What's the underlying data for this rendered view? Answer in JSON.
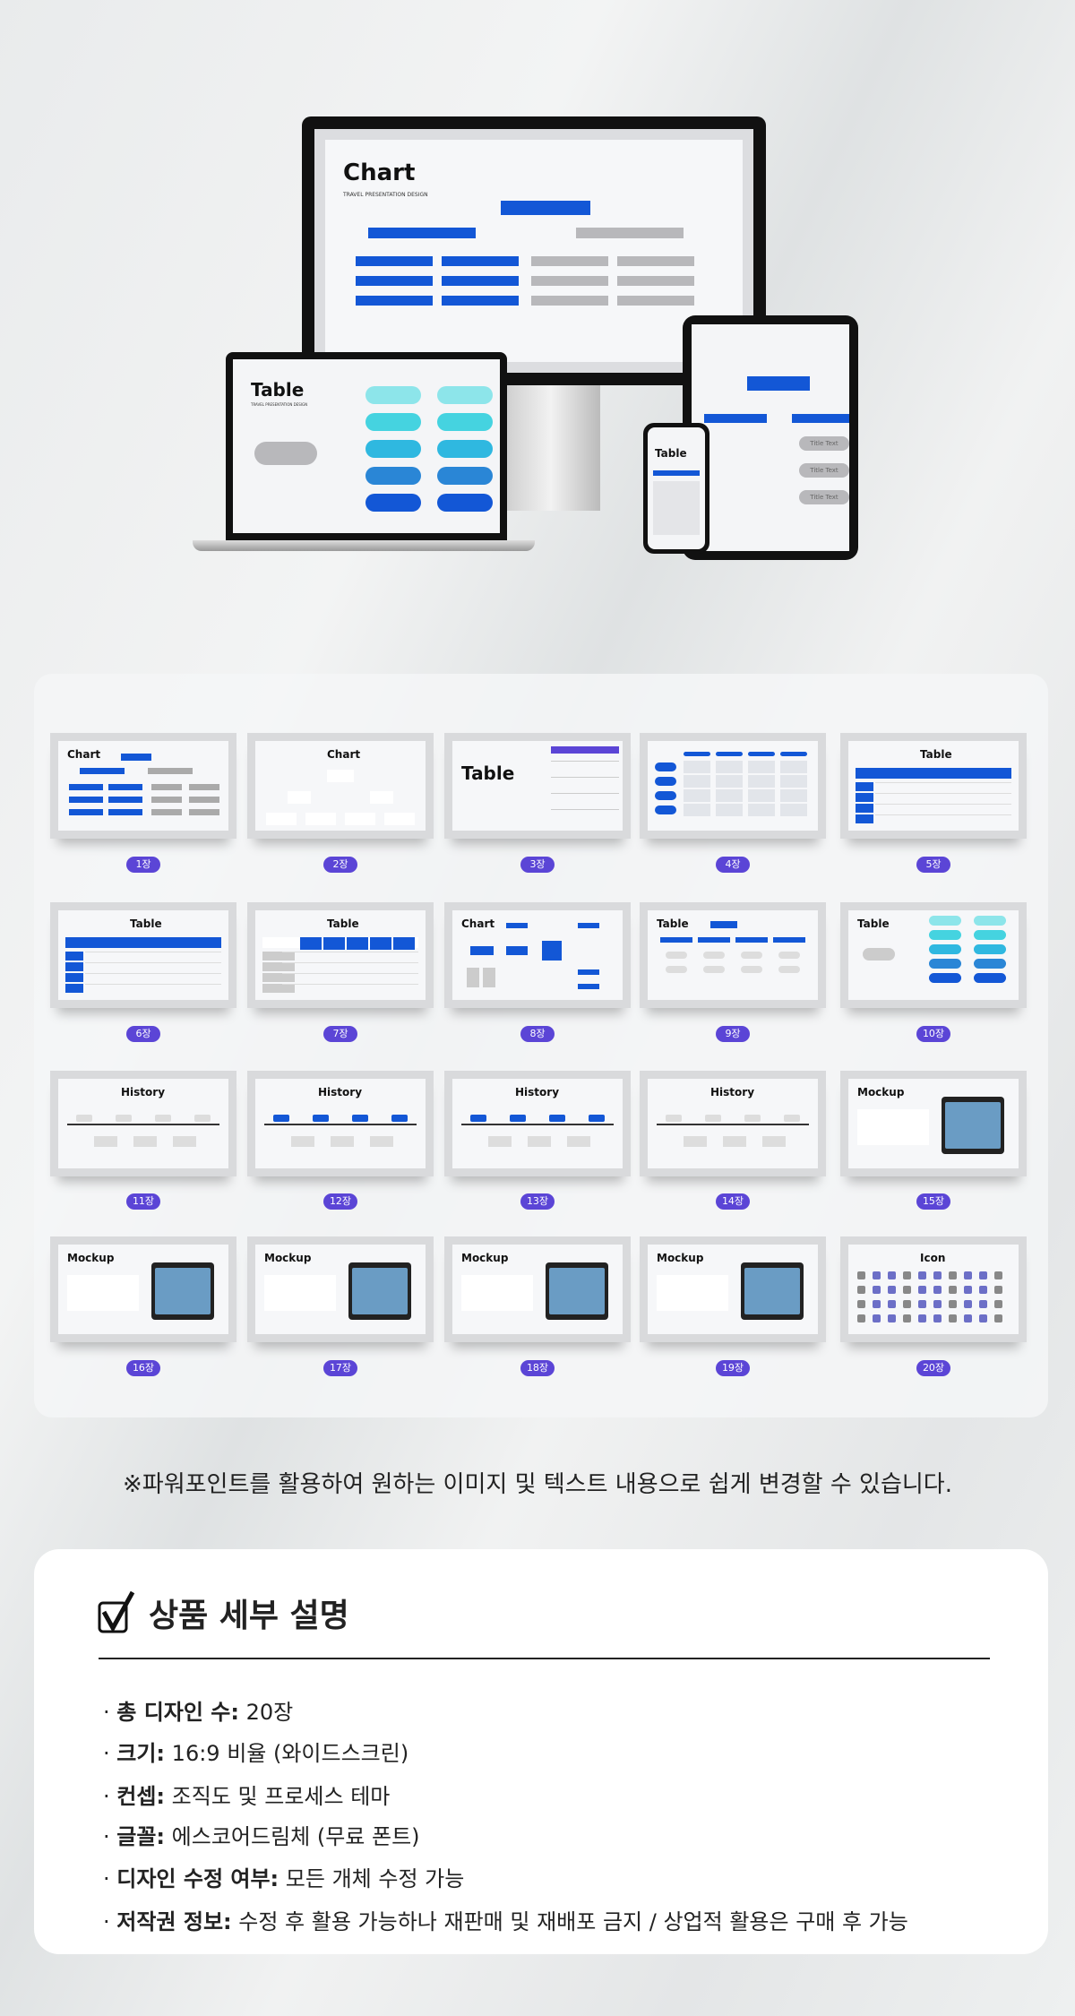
{
  "devices": {
    "monitor": {
      "title": "Chart",
      "subtitle": "TRAVEL PRESENTATION DESIGN"
    },
    "laptop": {
      "title": "Table",
      "subtitle": "TRAVEL PRESENTATION DESIGN"
    },
    "tablet": {
      "labels": [
        "Title Text",
        "Title Text",
        "Title Text"
      ]
    },
    "phone": {
      "title": "Table"
    }
  },
  "slides": [
    {
      "title": "Chart",
      "badge": "1장",
      "kind": "org"
    },
    {
      "title": "Chart",
      "badge": "2장",
      "kind": "org2"
    },
    {
      "title": "Table",
      "badge": "3장",
      "kind": "table3"
    },
    {
      "title": "",
      "badge": "4장",
      "kind": "table4"
    },
    {
      "title": "Table",
      "badge": "5장",
      "kind": "table"
    },
    {
      "title": "Table",
      "badge": "6장",
      "kind": "table"
    },
    {
      "title": "Table",
      "badge": "7장",
      "kind": "table7"
    },
    {
      "title": "Chart",
      "badge": "8장",
      "kind": "flow"
    },
    {
      "title": "Table",
      "badge": "9장",
      "kind": "tree"
    },
    {
      "title": "Table",
      "badge": "10장",
      "kind": "pills"
    },
    {
      "title": "History",
      "badge": "11장",
      "kind": "timeline"
    },
    {
      "title": "History",
      "badge": "12장",
      "kind": "history"
    },
    {
      "title": "History",
      "badge": "13장",
      "kind": "history"
    },
    {
      "title": "History",
      "badge": "14장",
      "kind": "timeline"
    },
    {
      "title": "Mockup",
      "badge": "15장",
      "kind": "mockup"
    },
    {
      "title": "Mockup",
      "badge": "16장",
      "kind": "mockup"
    },
    {
      "title": "Mockup",
      "badge": "17장",
      "kind": "mockup"
    },
    {
      "title": "Mockup",
      "badge": "18장",
      "kind": "mockup"
    },
    {
      "title": "Mockup",
      "badge": "19장",
      "kind": "mockup"
    },
    {
      "title": "Icon",
      "badge": "20장",
      "kind": "icons"
    }
  ],
  "caption": "※파워포인트를 활용하여 원하는 이미지 및 텍스트 내용으로 쉽게 변경할 수 있습니다.",
  "details": {
    "title": "상품 세부 설명",
    "items": [
      {
        "label": "총 디자인 수:",
        "value": "20장"
      },
      {
        "label": "크기:",
        "value": "16:9 비율 (와이드스크린)"
      },
      {
        "label": "컨셉:",
        "value": "조직도 및 프로세스 테마"
      },
      {
        "label": "글꼴:",
        "value": "에스코어드림체 (무료 폰트)"
      },
      {
        "label": "디자인 수정 여부:",
        "value": "모든 개체 수정 가능"
      },
      {
        "label": "저작권 정보:",
        "value": "수정 후 활용 가능하나 재판매 및 재배포 금지 / 상업적 활용은 구매 후 가능"
      }
    ]
  },
  "colors": {
    "accent": "#1357d6",
    "badge": "#5b45d6",
    "cyan": "#45d3e0"
  }
}
